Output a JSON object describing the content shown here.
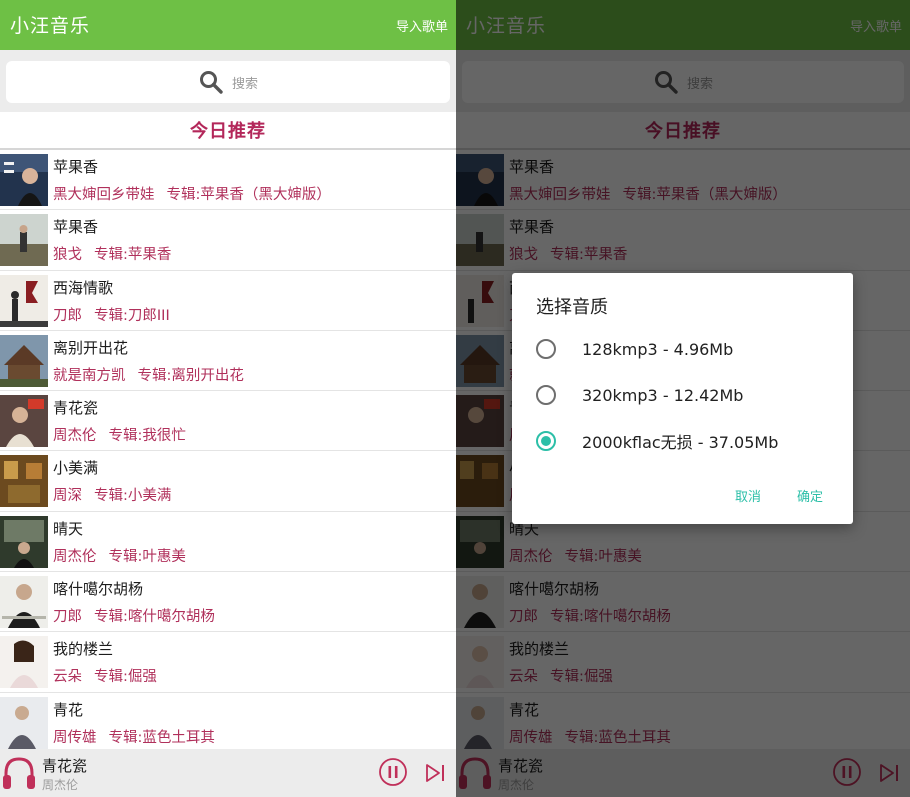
{
  "app": {
    "title": "小汪音乐",
    "import_label": "导入歌单"
  },
  "search": {
    "icon": "search-icon",
    "placeholder": "搜索"
  },
  "section_title": "今日推荐",
  "songs": [
    {
      "title": "苹果香",
      "artist": "黑大婶回乡带娃",
      "album": "专辑:苹果香（黑大婶版）"
    },
    {
      "title": "苹果香",
      "artist": "狼戈",
      "album": "专辑:苹果香"
    },
    {
      "title": "西海情歌",
      "artist": "刀郎",
      "album": "专辑:刀郎III"
    },
    {
      "title": "离别开出花",
      "artist": "就是南方凯",
      "album": "专辑:离别开出花"
    },
    {
      "title": "青花瓷",
      "artist": "周杰伦",
      "album": "专辑:我很忙"
    },
    {
      "title": "小美满",
      "artist": "周深",
      "album": "专辑:小美满"
    },
    {
      "title": "晴天",
      "artist": "周杰伦",
      "album": "专辑:叶惠美"
    },
    {
      "title": "喀什噶尔胡杨",
      "artist": "刀郎",
      "album": "专辑:喀什噶尔胡杨"
    },
    {
      "title": "我的楼兰",
      "artist": "云朵",
      "album": "专辑:倔强"
    },
    {
      "title": "青花",
      "artist": "周传雄",
      "album": "专辑:蓝色土耳其"
    }
  ],
  "player": {
    "title": "青花瓷",
    "artist": "周杰伦",
    "state": "playing"
  },
  "dialog": {
    "title": "选择音质",
    "options": [
      {
        "label": "128kmp3 - 4.96Mb",
        "selected": false
      },
      {
        "label": "320kmp3 - 12.42Mb",
        "selected": false
      },
      {
        "label": "2000kflac无损 - 37.05Mb",
        "selected": true
      }
    ],
    "cancel_label": "取消",
    "ok_label": "确定"
  },
  "colors": {
    "appbar": "#6ec045",
    "accent_text": "#b0305b",
    "section_title": "#b3275a",
    "dialog_accent": "#2cbfa8",
    "player_icons": "#c0305a"
  }
}
